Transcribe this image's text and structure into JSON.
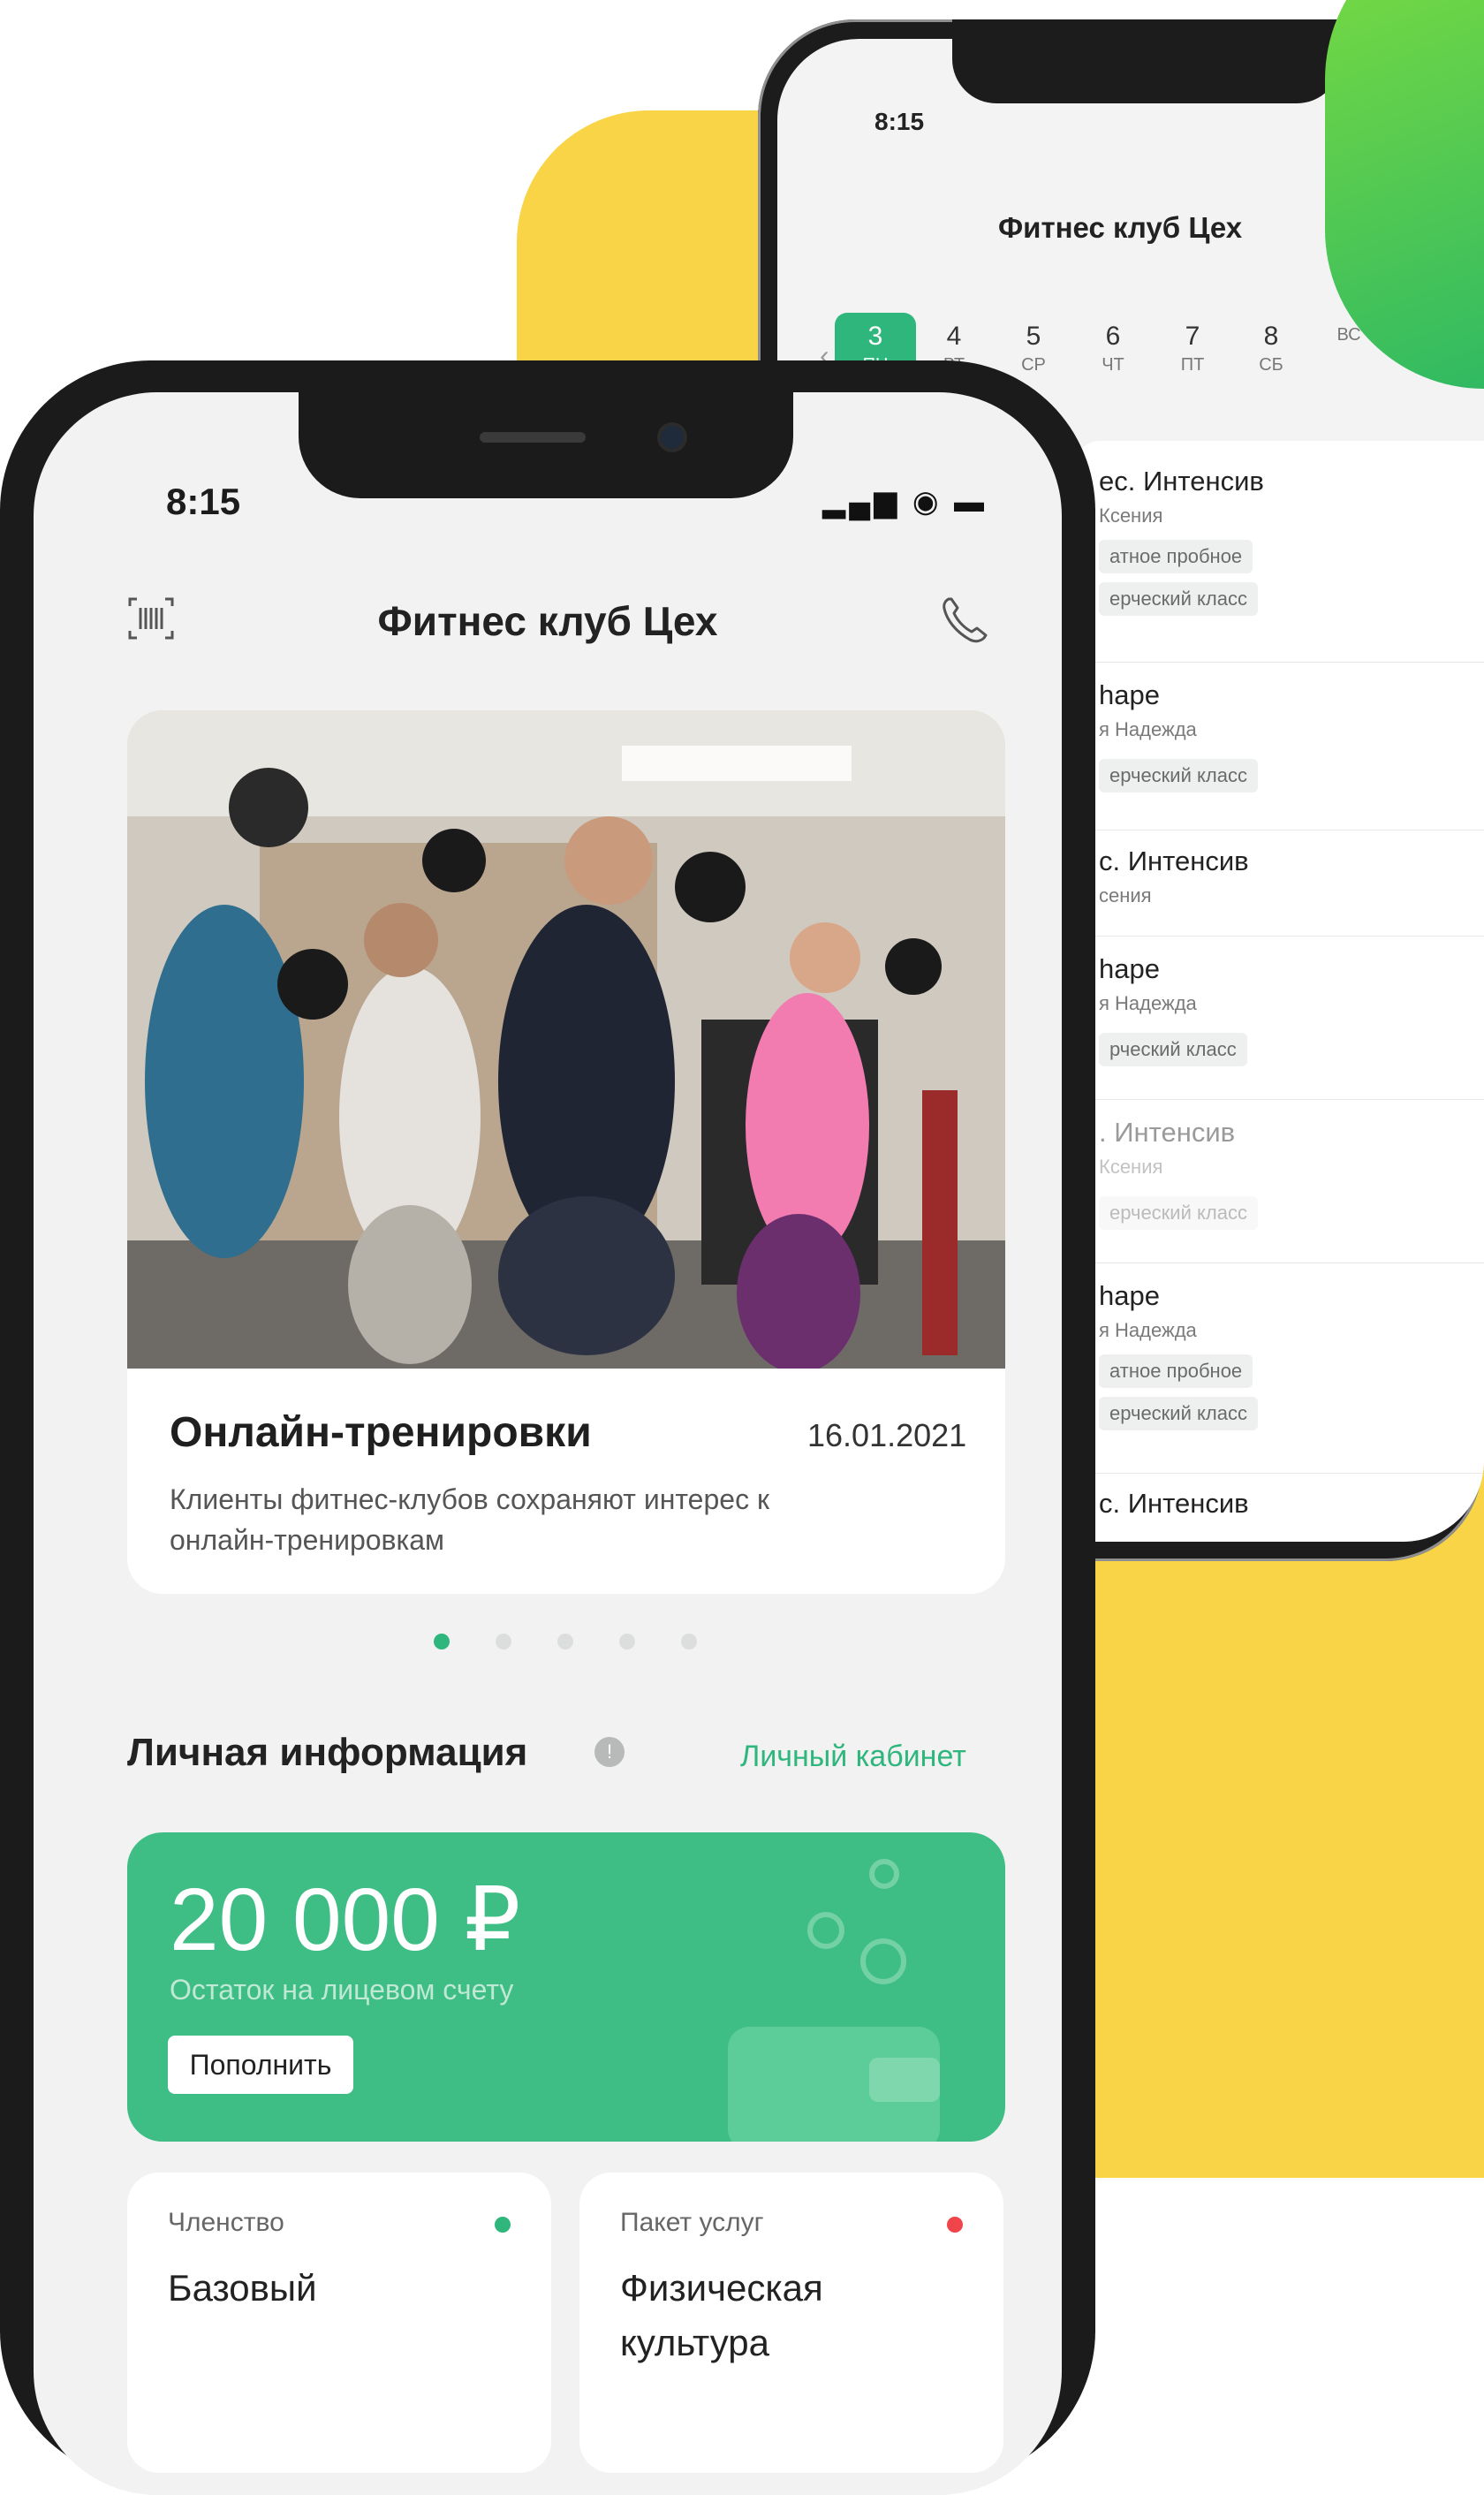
{
  "background": {
    "accent_yellow": "#f9d447",
    "accent_green": "#2fb67d"
  },
  "back_phone": {
    "status_time": "8:15",
    "title": "Фитнес клуб Цех",
    "info_icon": "info-icon",
    "days": [
      {
        "num": "3",
        "dow": "ПН"
      },
      {
        "num": "4",
        "dow": "ВТ"
      },
      {
        "num": "5",
        "dow": "СР"
      },
      {
        "num": "6",
        "dow": "ЧТ"
      },
      {
        "num": "7",
        "dow": "ПТ"
      },
      {
        "num": "8",
        "dow": "СБ"
      },
      {
        "num": "",
        "dow": "ВС"
      }
    ],
    "schedule": [
      {
        "title": "ес. Интенсив",
        "sub": "Ксения",
        "tags": [
          "атное пробное",
          "ерческий класс"
        ]
      },
      {
        "title": "hape",
        "sub": "я Надежда",
        "tags": [
          "ерческий класс"
        ]
      },
      {
        "title": "с. Интенсив",
        "sub": "сения",
        "tags": []
      },
      {
        "title": "hape",
        "sub": "я Надежда",
        "tags": [
          "рческий класс"
        ]
      },
      {
        "title": ". Интенсив",
        "sub": "Ксения",
        "tags": [
          "ерческий класс"
        ]
      },
      {
        "title": "hape",
        "sub": "я Надежда",
        "tags": [
          "атное пробное",
          "ерческий класс"
        ]
      },
      {
        "title": "с. Интенсив",
        "sub": "",
        "tags": []
      }
    ]
  },
  "front_phone": {
    "status_time": "8:15",
    "status_icons": "▂▄▆ ◉ ▬",
    "title": "Фитнес клуб Цех",
    "news": {
      "title": "Онлайн-тренировки",
      "date": "16.01.2021",
      "text": "Клиенты фитнес-клубов сохраняют интерес к онлайн-тренировкам"
    },
    "carousel": {
      "count": 5,
      "active": 0
    },
    "section_title": "Личная информация",
    "section_link": "Личный кабинет",
    "balance": {
      "amount": "20 000 ₽",
      "label": "Остаток на лицевом счету",
      "button": "Пополнить"
    },
    "membership": {
      "label": "Членство",
      "value": "Базовый",
      "status_color": "#2fb67d"
    },
    "package": {
      "label": "Пакет услуг",
      "value": "Физическая культура",
      "status_color": "#f0444b"
    }
  }
}
